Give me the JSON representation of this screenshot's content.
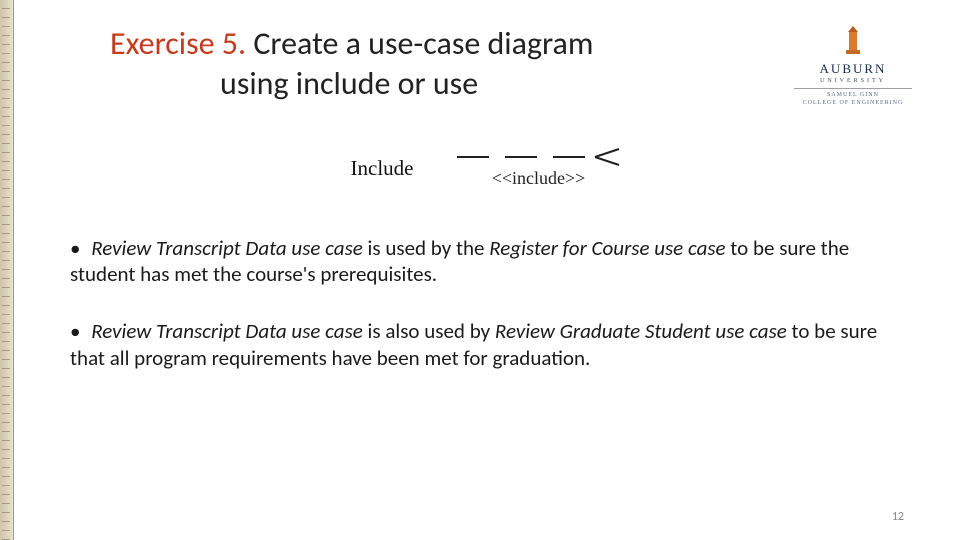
{
  "title": {
    "prefix": "Exercise 5.",
    "rest_line1": " Create a use-case diagram",
    "line2": "using include or use"
  },
  "logo": {
    "name": "AUBURN",
    "university": "UNIVERSITY",
    "sub1": "SAMUEL GINN",
    "sub2": "COLLEGE OF ENGINEERING",
    "tower_color": "#d97a2e",
    "name_color": "#1a2a4a"
  },
  "uml": {
    "label": "Include",
    "stereotype": "<<include>>"
  },
  "bullets": [
    {
      "parts": [
        {
          "t": "• ",
          "cls": "bullet-mark"
        },
        {
          "t": "Review Transcript Data use case",
          "cls": "ital"
        },
        {
          "t": " is used by the "
        },
        {
          "t": "Register for Course use case",
          "cls": "ital"
        },
        {
          "t": " to be sure the student has met the course's prerequisites."
        }
      ]
    },
    {
      "parts": [
        {
          "t": "• ",
          "cls": "bullet-mark"
        },
        {
          "t": "Review Transcript Data use case",
          "cls": "ital"
        },
        {
          "t": " is also used by "
        },
        {
          "t": "Review Graduate Student use case",
          "cls": "ital"
        },
        {
          "t": " to be sure that all program  requirements have been met for graduation."
        }
      ]
    }
  ],
  "page_number": "12"
}
